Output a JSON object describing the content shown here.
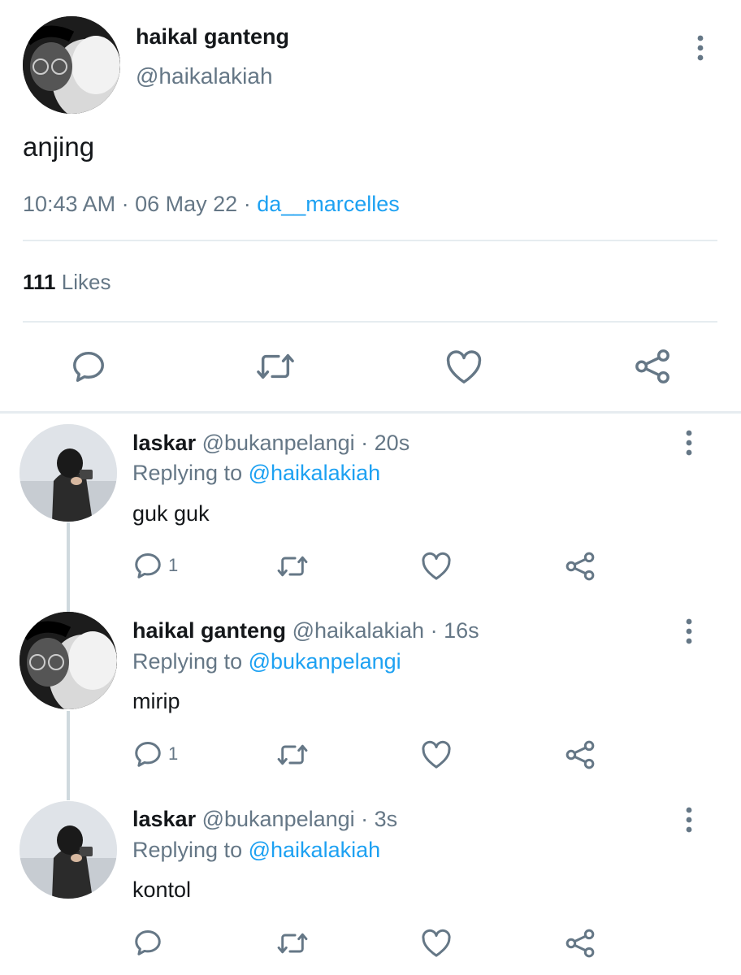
{
  "main_tweet": {
    "author_name": "haikal ganteng",
    "handle": "@haikalakiah",
    "text": "anjing",
    "time": "10:43 AM",
    "sep1": "·",
    "date": "06 May 22",
    "sep2": "·",
    "source": "da__marcelles",
    "likes_count": "111",
    "likes_label": "Likes"
  },
  "replies": [
    {
      "author_name": "laskar",
      "handle": "@bukanpelangi",
      "time": "· 20s",
      "replying_prefix": "Replying to",
      "replying_to": "@haikalakiah",
      "text": "guk guk",
      "reply_count": "1"
    },
    {
      "author_name": "haikal ganteng",
      "handle": "@haikalakiah",
      "time": "· 16s",
      "replying_prefix": "Replying to",
      "replying_to": "@bukanpelangi",
      "text": "mirip",
      "reply_count": "1"
    },
    {
      "author_name": "laskar",
      "handle": "@bukanpelangi",
      "time": "· 3s",
      "replying_prefix": "Replying to",
      "replying_to": "@haikalakiah",
      "text": "kontol",
      "reply_count": ""
    }
  ],
  "icons": {
    "reply": "comment-icon",
    "retweet": "retweet-icon",
    "like": "heart-icon",
    "share": "share-icon",
    "more": "more-vertical-icon"
  },
  "colors": {
    "accent": "#1da1f2",
    "text": "#14171a",
    "muted": "#657786",
    "divider": "#e6ecf0"
  }
}
